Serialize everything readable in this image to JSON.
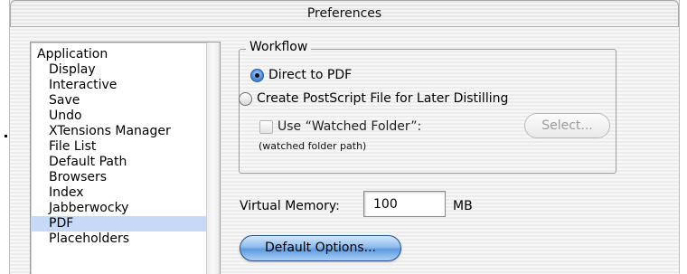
{
  "window": {
    "title": "Preferences"
  },
  "sidebar": {
    "items": [
      {
        "label": "Application"
      },
      {
        "label": "Display"
      },
      {
        "label": "Interactive"
      },
      {
        "label": "Save"
      },
      {
        "label": "Undo"
      },
      {
        "label": "XTensions Manager"
      },
      {
        "label": "File List"
      },
      {
        "label": "Default Path"
      },
      {
        "label": "Browsers"
      },
      {
        "label": "Index"
      },
      {
        "label": "Jabberwocky"
      },
      {
        "label": "PDF",
        "selected": true
      },
      {
        "label": "Placeholders"
      }
    ],
    "selected_color": "#c6d9f6"
  },
  "workflow": {
    "label": "Workflow",
    "option_direct": "Direct to PDF",
    "option_postscript": "Create PostScript File for Later Distilling",
    "selected_option": "Direct to PDF",
    "watched_folder_label": "Use “Watched Folder”:",
    "watched_folder_checked": false,
    "select_button_label": "Select...",
    "watched_folder_path": "(watched folder path)"
  },
  "virtual_memory": {
    "label": "Virtual Memory:",
    "value": "100",
    "unit": "MB"
  },
  "buttons": {
    "default_options_label": "Default Options..."
  },
  "colors": {
    "accent_button": "#5e9be0"
  }
}
